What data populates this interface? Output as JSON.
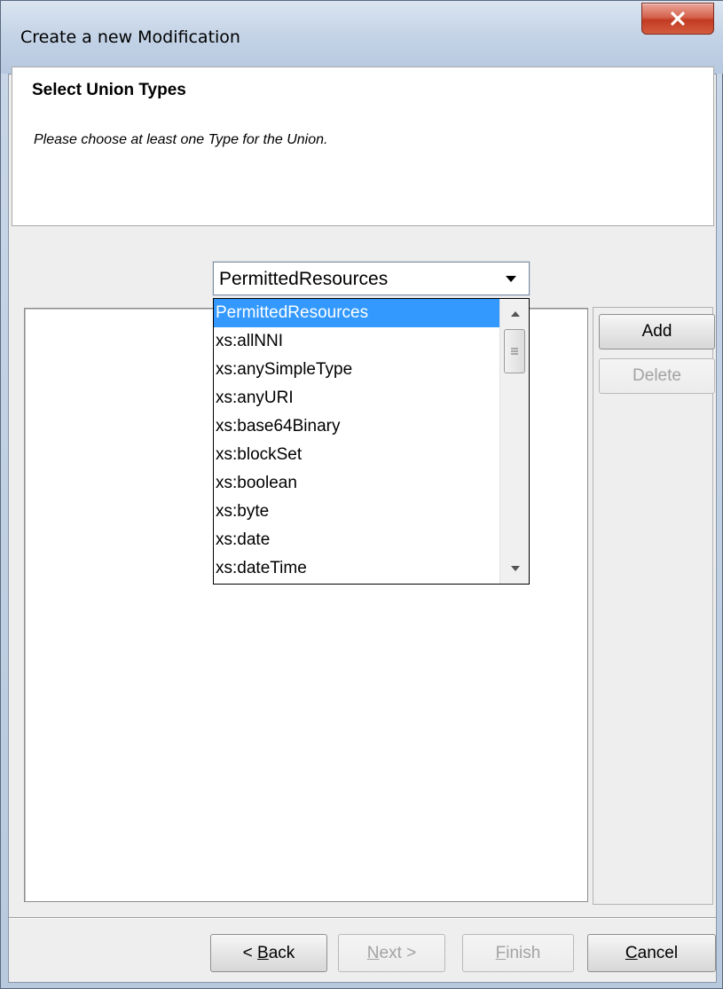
{
  "window": {
    "title": "Create a new Modification",
    "close_icon": "close-icon"
  },
  "header": {
    "title": "Select Union Types",
    "description": "Please choose at least one Type for the Union."
  },
  "combo": {
    "selected": "PermittedResources",
    "expanded": true,
    "options": [
      "PermittedResources",
      "xs:allNNI",
      "xs:anySimpleType",
      "xs:anyURI",
      "xs:base64Binary",
      "xs:blockSet",
      "xs:boolean",
      "xs:byte",
      "xs:date",
      "xs:dateTime"
    ],
    "highlighted_index": 0
  },
  "side_buttons": {
    "add": "Add",
    "delete": "Delete"
  },
  "footer": {
    "back_prefix": "< ",
    "back_mnemonic": "B",
    "back_rest": "ack",
    "next_mnemonic": "N",
    "next_rest": "ext >",
    "finish_mnemonic": "F",
    "finish_rest": "inish",
    "cancel_mnemonic": "C",
    "cancel_rest": "ancel"
  },
  "colors": {
    "selection": "#3399ff",
    "close_button": "#c23b22"
  }
}
